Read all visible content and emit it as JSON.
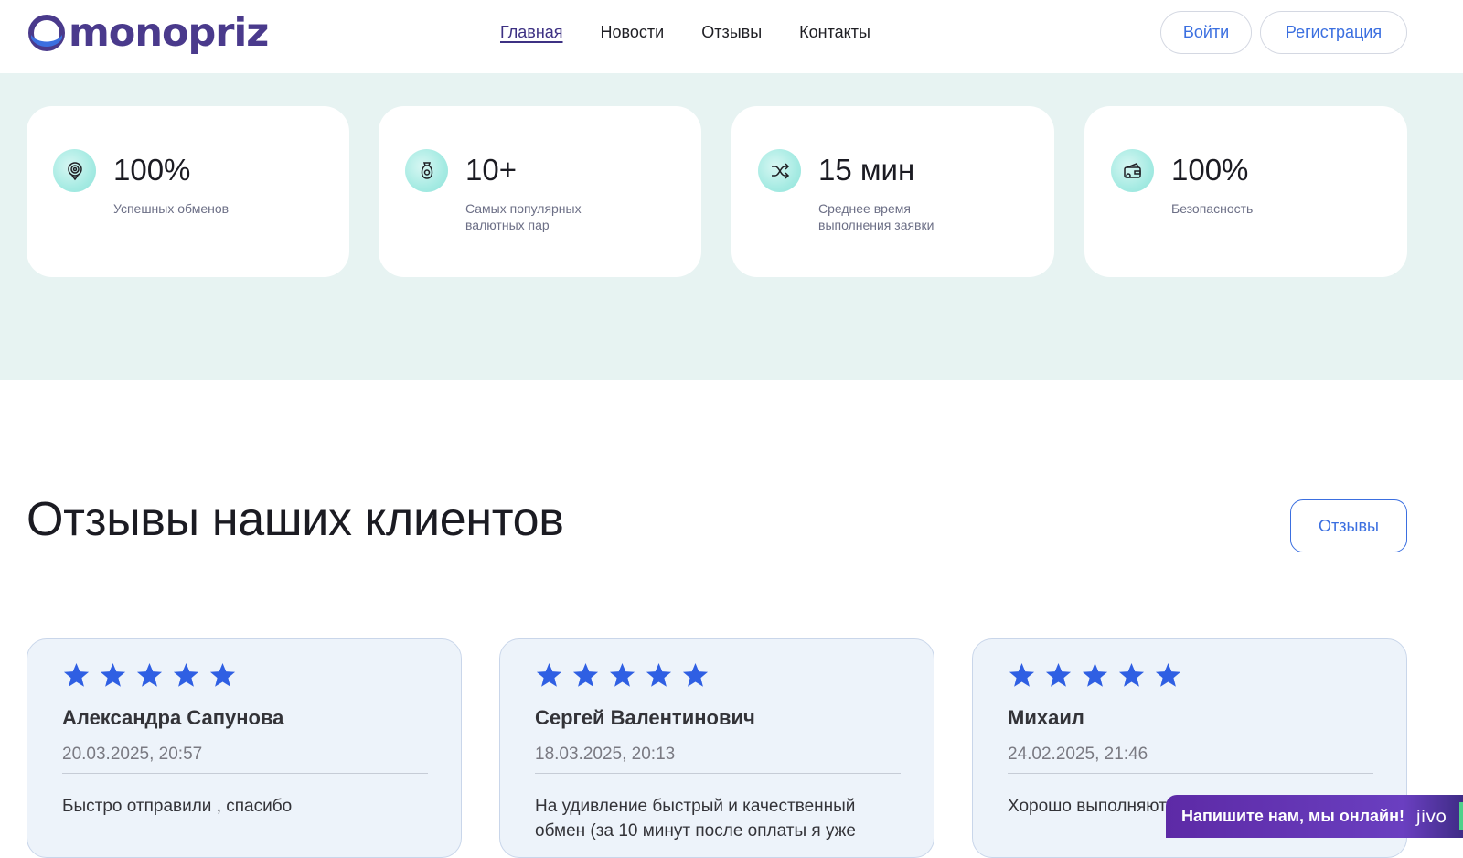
{
  "header": {
    "logo_text": "monopriz",
    "nav": [
      "Главная",
      "Новости",
      "Отзывы",
      "Контакты"
    ],
    "active_nav": "Главная",
    "login_label": "Войти",
    "register_label": "Регистрация"
  },
  "stats": [
    {
      "value": "100%",
      "label": "Успешных обменов",
      "icon": "badge-icon"
    },
    {
      "value": "10+",
      "label": "Самых популярных валютных пар",
      "icon": "coin-bag-icon"
    },
    {
      "value": "15 мин",
      "label": "Среднее время выполнения заявки",
      "icon": "shuffle-icon"
    },
    {
      "value": "100%",
      "label": "Безопасность",
      "icon": "wallet-icon"
    }
  ],
  "reviews_section": {
    "title": "Отзывы наших клиентов",
    "button_label": "Отзывы"
  },
  "reviews": [
    {
      "name": "Александра Сапунова",
      "date": "20.03.2025, 20:57",
      "rating": 5,
      "text": "Быстро отправили , спасибо"
    },
    {
      "name": "Сергей Валентинович",
      "date": "18.03.2025, 20:13",
      "rating": 5,
      "text": "На удивление быстрый и качественный обмен (за 10 минут после оплаты я уже"
    },
    {
      "name": "Михаил",
      "date": "24.02.2025, 21:46",
      "rating": 5,
      "text": "Хорошо выполняют качественный серв"
    }
  ],
  "chat": {
    "label": "Напишите нам, мы онлайн!",
    "brand": "jivo"
  },
  "colors": {
    "accent": "#3b6fe0",
    "brand": "#4a3a8c",
    "star": "#2f5fe3",
    "band": "#e7f3f2"
  }
}
